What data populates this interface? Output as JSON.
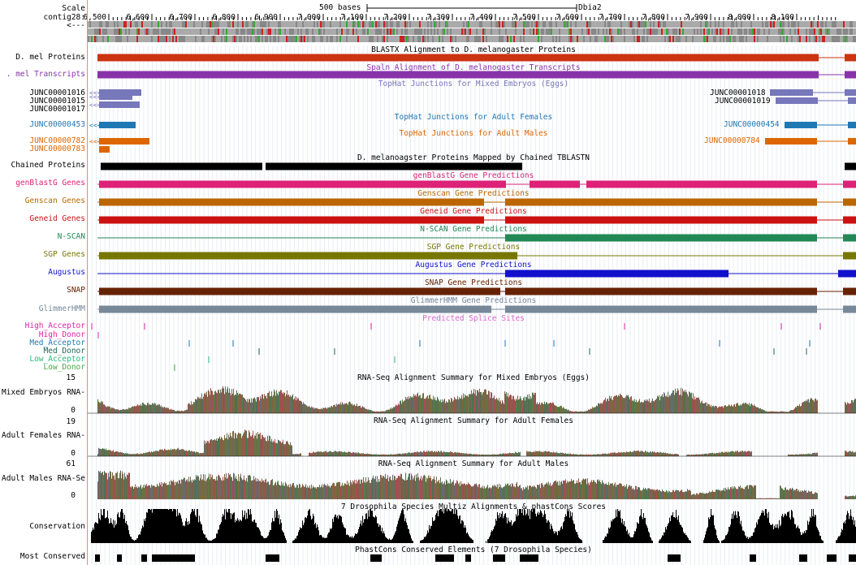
{
  "ruler": {
    "scale_label": "Scale",
    "contig_label": "contig28:",
    "arrow_label": "<---",
    "scalebar_text": "500 bases",
    "assembly": "Dbia2",
    "ticks": [
      "6,500",
      "6,600",
      "6,700",
      "6,800",
      "6,900",
      "7,000",
      "7,100",
      "7,200",
      "7,300",
      "7,400",
      "7,500",
      "7,600",
      "7,700",
      "7,800",
      "7,900",
      "8,000",
      "8,100"
    ]
  },
  "tracks": {
    "blastx": {
      "label": "D. mel Proteins",
      "title": "BLASTX Alignment to D. melanogaster Proteins",
      "color": "#cc3311"
    },
    "spaln": {
      "label": ". mel Transcripts",
      "title": "Spaln Alignment of D. melanogaster Transcripts",
      "color": "#8833aa"
    },
    "tophat_embryos": {
      "title": "TopHat Junctions for Mixed Embryos (Eggs)",
      "color": "#7777bb",
      "items_left": [
        "JUNC00001016",
        "JUNC00001015",
        "JUNC00001017"
      ],
      "items_right": [
        "JUNC00001018",
        "JUNC00001019"
      ]
    },
    "tophat_females": {
      "title": "TopHat Junctions for Adult Females",
      "color": "#1f77b4",
      "item_left": "JUNC00000453",
      "item_right": "JUNC00000454"
    },
    "tophat_males": {
      "title": "TopHat Junctions for Adult Males",
      "color": "#dd6600",
      "items_left": [
        "JUNC00000782",
        "JUNC00000783"
      ],
      "item_right": "JUNC00000784"
    },
    "chained": {
      "label": "Chained Proteins",
      "title": "D. melanoagster Proteins Mapped by Chained TBLASTN",
      "color": "#000000"
    },
    "genblastg": {
      "label": "genBlastG Genes",
      "title": "genBlastG Gene Predictions",
      "color": "#dd2277"
    },
    "genscan": {
      "label": "Genscan Genes",
      "title": "Genscan Gene Predictions",
      "color": "#bb6600"
    },
    "geneid": {
      "label": "Geneid Genes",
      "title": "Geneid Gene Predictions",
      "color": "#cc1111"
    },
    "nscan": {
      "label": "N-SCAN",
      "title": "N-SCAN Gene Predictions",
      "color": "#228855"
    },
    "sgp": {
      "label": "SGP Genes",
      "title": "SGP Gene Predictions",
      "color": "#777700"
    },
    "augustus": {
      "label": "Augustus",
      "title": "Augustus Gene Predictions",
      "color": "#1111cc"
    },
    "snap": {
      "label": "SNAP",
      "title": "SNAP Gene Predictions",
      "color": "#662200"
    },
    "glimmer": {
      "label": "GlimmerHMM",
      "title": "GlimmerHMM Gene Predictions",
      "color": "#778899"
    },
    "splice": {
      "title": "Predicted Splice Sites",
      "rows": [
        {
          "label": "High_Acceptor",
          "color": "#dd22aa"
        },
        {
          "label": "High_Donor",
          "color": "#dd22aa"
        },
        {
          "label": "Med_Acceptor",
          "color": "#1f77b4"
        },
        {
          "label": "Med_Donor",
          "color": "#226655"
        },
        {
          "label": "Low_Acceptor",
          "color": "#22bb77"
        },
        {
          "label": "Low_Donor",
          "color": "#44aa44"
        }
      ]
    },
    "rna_embryos": {
      "label": "Mixed Embryos RNA-",
      "title": "RNA-Seq Alignment Summary for Mixed Embryos (Eggs)",
      "max": "15",
      "min": "0"
    },
    "rna_females": {
      "label": "Adult Females RNA-",
      "title": "RNA-Seq Alignment Summary for Adult Females",
      "max": "19",
      "min": "0"
    },
    "rna_males": {
      "label": "Adult Males RNA-Se",
      "title": "RNA-Seq Alignment Summary for Adult Males",
      "max": "61",
      "min": "0"
    },
    "conservation": {
      "label": "Conservation",
      "title": "7 Drosophila Species Multiz Alignments & phastCons Scores"
    },
    "most_conserved": {
      "label": "Most Conserved",
      "title": "PhastCons Conserved Elements (7 Drosophila Species)"
    }
  }
}
